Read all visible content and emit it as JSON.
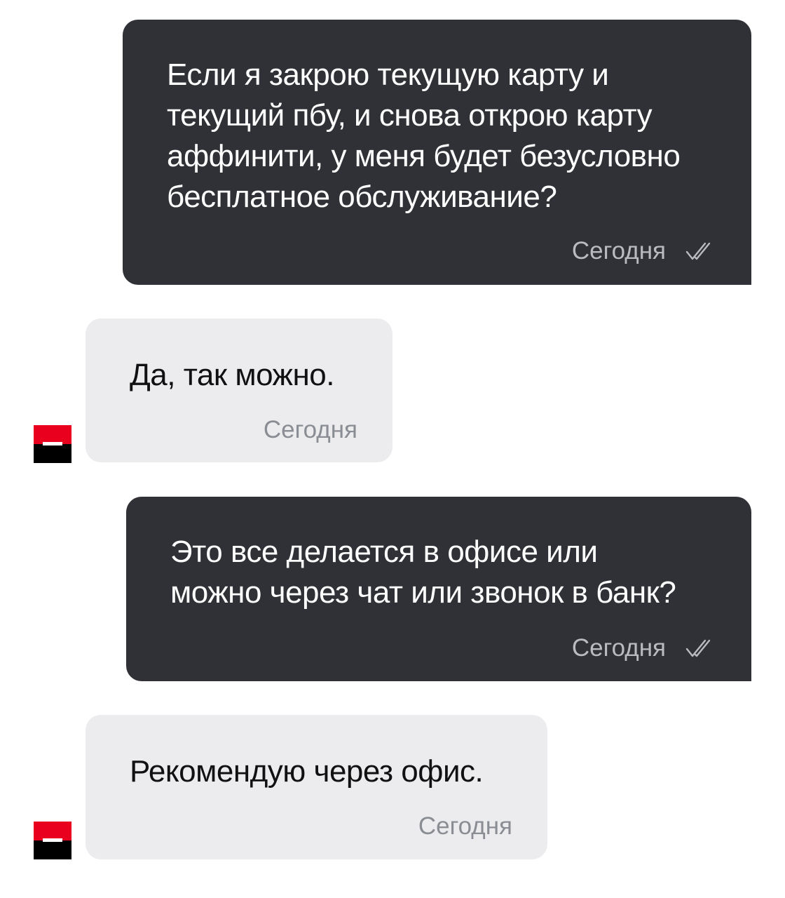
{
  "messages": [
    {
      "sender": "user",
      "text": "Если я закрою текущую карту и\nтекущий пбу, и снова открою карту\nаффинити, у меня будет безусловно\nбесплатное обслуживание?",
      "time": "Сегодня",
      "status_icon": "double-check-icon"
    },
    {
      "sender": "bank",
      "text": "Да, так можно.",
      "time": "Сегодня",
      "avatar_icon": "bank-logo-icon"
    },
    {
      "sender": "user",
      "text": "Это все делается в офисе или\nможно через чат или звонок в банк?",
      "time": "Сегодня",
      "status_icon": "double-check-icon"
    },
    {
      "sender": "bank",
      "text": "Рекомендую через офис.",
      "time": "Сегодня",
      "avatar_icon": "bank-logo-icon"
    }
  ],
  "colors": {
    "outgoing_bubble": "#2f3136",
    "incoming_bubble": "#ececef",
    "logo_red": "#e9001e",
    "logo_black": "#000000"
  }
}
